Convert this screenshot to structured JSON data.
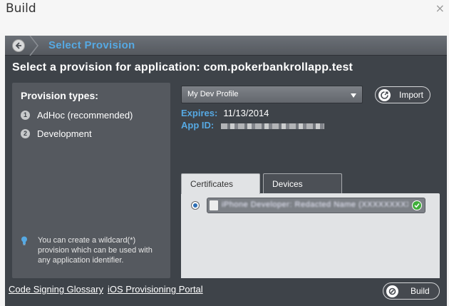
{
  "window": {
    "title": "Build",
    "close_glyph": "×"
  },
  "header": {
    "title": "Select Provision"
  },
  "subtitle": "Select a provision for application: com.pokerbankrollapp.test",
  "provision_types": {
    "title": "Provision types:",
    "items": [
      {
        "number": "1",
        "label": "AdHoc (recommended)"
      },
      {
        "number": "2",
        "label": "Development"
      }
    ],
    "hint": "You can create a wildcard(*) provision which can be used with any application identifier."
  },
  "profile": {
    "selected": "My Dev Profile",
    "import_label": "Import",
    "expires_label": "Expires:",
    "expires_value": "11/13/2014",
    "app_id_label": "App ID:"
  },
  "tabs": [
    {
      "label": "Certificates",
      "active": true
    },
    {
      "label": "Devices",
      "active": false
    }
  ],
  "certificates": [
    {
      "name": "iPhone Developer: Redacted Name (XXXXXXXXXX)",
      "selected": true,
      "valid": true
    }
  ],
  "footer": {
    "links": [
      "Code Signing Glossary",
      "iOS Provisioning Portal"
    ],
    "build_label": "Build"
  },
  "colors": {
    "accent": "#56a9e3",
    "panel": "#55595f",
    "dialog": "#3e4349",
    "valid": "#3fae3a"
  },
  "icons": [
    "back-arrow-icon",
    "import-icon",
    "lightbulb-icon",
    "certificate-icon",
    "checkmark-icon",
    "build-icon"
  ]
}
